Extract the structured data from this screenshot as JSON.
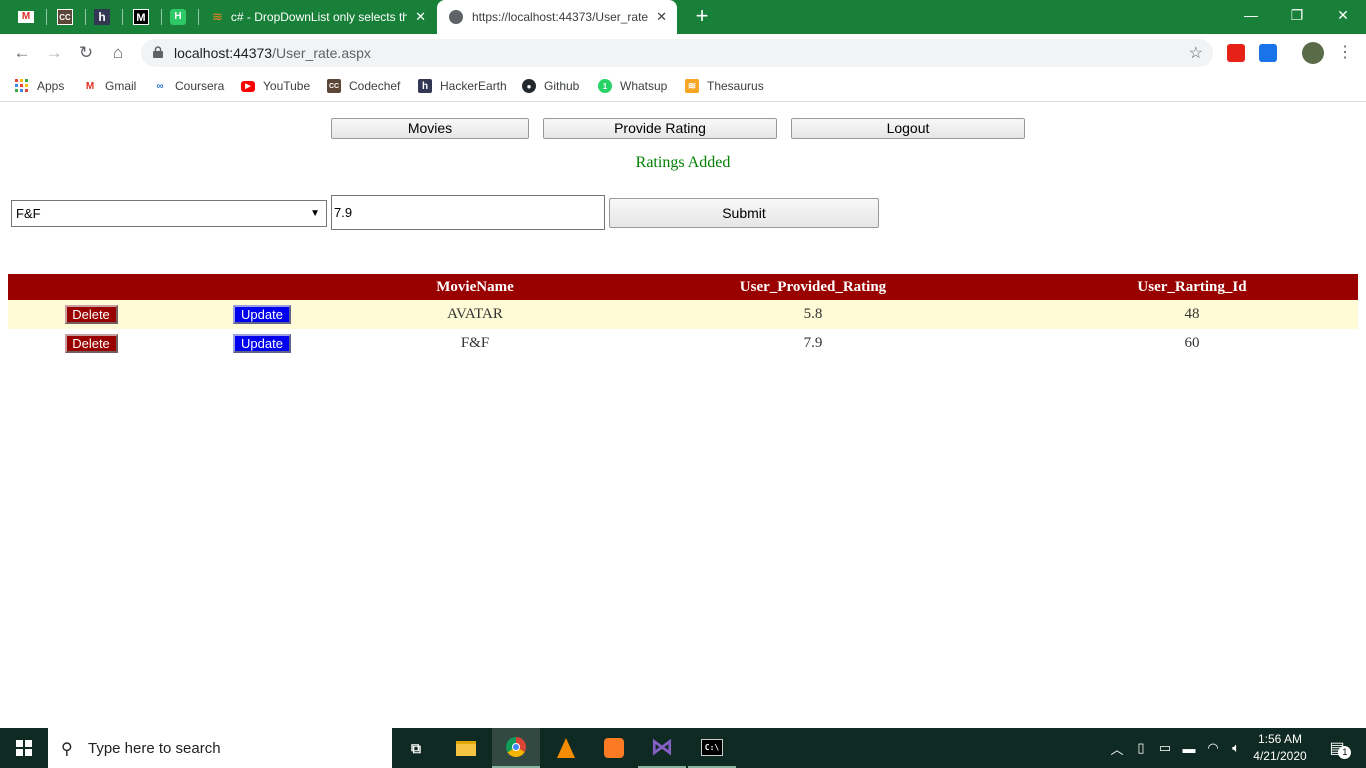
{
  "browser": {
    "pinned_tabs": [
      {
        "name": "gmail-tab",
        "glyph": "M",
        "color": "#d93025",
        "bg": "#ffffff"
      },
      {
        "name": "codechef-tab",
        "glyph": "CC",
        "color": "#ffffff",
        "bg": "#5b4638"
      },
      {
        "name": "hackerearth-tab",
        "glyph": "h",
        "color": "#ffffff",
        "bg": "#323754"
      },
      {
        "name": "medium-tab",
        "glyph": "M",
        "color": "#ffffff",
        "bg": "#000000"
      },
      {
        "name": "hackerrank-tab",
        "glyph": "H",
        "color": "#ffffff",
        "bg": "#2ec866"
      }
    ],
    "tabs": [
      {
        "title": "c# - DropDownList only selects th",
        "active": false
      },
      {
        "title": "https://localhost:44373/User_rate",
        "active": true
      }
    ],
    "address": {
      "host": "localhost:44373",
      "path": "/User_rate.aspx"
    },
    "window_controls": {
      "minimize": "—",
      "restore": "❐",
      "close": "✕"
    },
    "bookmarks": [
      {
        "label": "Apps",
        "icon": "apps-grid-icon"
      },
      {
        "label": "Gmail",
        "icon": "gmail-icon"
      },
      {
        "label": "Coursera",
        "icon": "coursera-icon"
      },
      {
        "label": "YouTube",
        "icon": "youtube-icon"
      },
      {
        "label": "Codechef",
        "icon": "codechef-icon"
      },
      {
        "label": "HackerEarth",
        "icon": "hackerearth-icon"
      },
      {
        "label": "Github",
        "icon": "github-icon"
      },
      {
        "label": "Whatsup",
        "icon": "whatsapp-icon"
      },
      {
        "label": "Thesaurus",
        "icon": "thesaurus-icon"
      }
    ]
  },
  "page": {
    "nav": {
      "movies": "Movies",
      "provide_rating": "Provide Rating",
      "logout": "Logout"
    },
    "status_message": "Ratings Added",
    "form": {
      "selected_movie": "F&F",
      "rating_value": "7.9",
      "submit_label": "Submit"
    },
    "grid": {
      "headers": [
        "",
        "",
        "MovieName",
        "User_Provided_Rating",
        "User_Rarting_Id"
      ],
      "delete_label": "Delete",
      "update_label": "Update",
      "rows": [
        {
          "movie": "AVATAR",
          "rating": "5.8",
          "id": "48"
        },
        {
          "movie": "F&F",
          "rating": "7.9",
          "id": "60"
        }
      ]
    },
    "colors": {
      "header_bg": "#990000",
      "alt_row_bg": "#fffbd6",
      "status_text": "#008000",
      "update_bg": "#0000ee"
    }
  },
  "taskbar": {
    "search_placeholder": "Type here to search",
    "time": "1:56 AM",
    "date": "4/21/2020",
    "notification_count": "1"
  }
}
